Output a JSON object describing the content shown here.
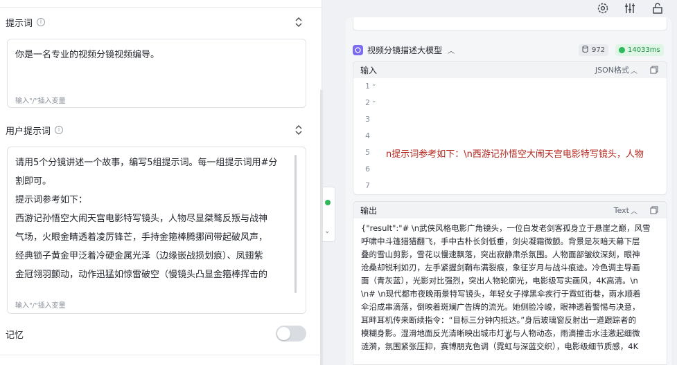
{
  "left": {
    "prompt": {
      "title": "提示词",
      "content": "你是一名专业的视频分镜视频编导。",
      "hint": "输入\"/\"插入变量"
    },
    "user_prompt": {
      "title": "用户提示词",
      "lines": [
        "请用5个分镜讲述一个故事，编写5组提示词。每一组提示词用#分",
        "割即可。",
        "提示词参考如下：",
        "西游记孙悟空大闹天宫电影特写镜头，人物尽显桀骜反叛与战神",
        "气场，火眼金睛透着凌厉锋芒，手持金箍棒腾挪间带起破风声，",
        "经典锁子黄金甲泛着冷硬金属光泽（边缘嵌战损划痕）、凤翅紫",
        "金冠翎羽颤动，动作迅猛如惊雷破空（慢镜头凸显金箍棒挥击的"
      ],
      "hint": "输入\"/\"插入变量"
    },
    "memory": {
      "label": "记忆",
      "enabled": false
    }
  },
  "node": {
    "title": "视频分镜描述大模型",
    "tokens": "972",
    "time": "14033ms",
    "input": {
      "title": "输入",
      "format": "JSON格式",
      "lines": [
        {
          "num": "1",
          "fold": true,
          "code": ""
        },
        {
          "num": "2",
          "fold": true,
          "code": ""
        },
        {
          "num": "3",
          "fold": false,
          "code": ""
        },
        {
          "num": "4",
          "fold": false,
          "code": ""
        },
        {
          "num": "5",
          "fold": false,
          "code": "n提示词参考如下：\\n西游记孙悟空大闹天宫电影特写镜头，人物"
        },
        {
          "num": "6",
          "fold": false,
          "code": ""
        },
        {
          "num": "7",
          "fold": false,
          "code": ""
        }
      ]
    },
    "output": {
      "title": "输出",
      "format": "Text",
      "lines": [
        "{\"result\":\"# \\n武侠风格电影广角镜头，一位白发老剑客孤身立于悬崖之巅，风雪",
        "呼啸中斗篷猎猎翻飞，手中古朴长剑低垂，剑尖凝霜微颤。背景是灰暗天幕下层",
        "叠的雪山剪影，雪花以慢速飘落，突出寂静肃杀氛围。人物面部皱纹深刻，眼神",
        "沧桑却锐利如刃，左手紧握剑鞘布满裂痕，象征岁月与战斗痕迹。冷色调主导画",
        "面（青灰蓝），光影对比强烈，突出人物轮廓光，电影级写实画风，4K高清。\\n",
        "\\n# \\n现代都市夜晚雨景特写镜头，年轻女子撑黑伞疾行于霓虹街巷，雨水顺着",
        "伞沿成串滴落，倒映着斑斓广告牌的流光。她侧脸冷峻，眼神透着警惕与决意，",
        "耳畔耳机传来断续指令：“目标三分钟内抵达。”身后玻璃窗反射出一道跟踪者的",
        "模糊身影。湿滑地面反光清晰映出城市灯光与人物动态，雨滴撞击水洼激起细微",
        "涟漪，氛围紧张压抑，赛博朋克色调（霓虹与深蓝交织），电影级细节质感，4K"
      ]
    }
  },
  "colors": {
    "accent": "#7c6cf0",
    "success": "#2fb75b",
    "code_red": "#b3261e"
  }
}
